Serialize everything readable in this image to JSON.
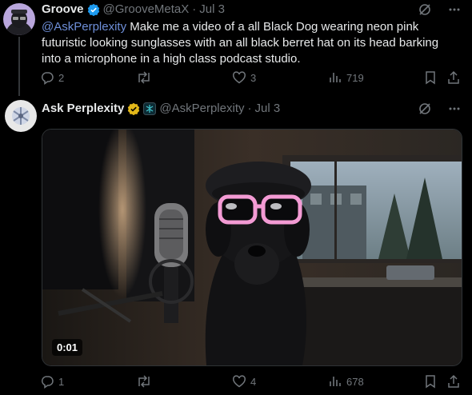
{
  "tweets": [
    {
      "author": "Groove",
      "handle": "@GrooveMetaX",
      "separator": "·",
      "date": "Jul 3",
      "mention": "@AskPerplexity",
      "text": " Make me a video of a all Black Dog wearing neon pink futuristic looking sunglasses with an all black berret hat on its head barking into a microphone in a high class podcast studio.",
      "replies": "2",
      "likes": "3",
      "views": "719"
    },
    {
      "author": "Ask Perplexity",
      "handle": "@AskPerplexity",
      "separator": "·",
      "date": "Jul 3",
      "video_timestamp": "0:01",
      "replies": "1",
      "likes": "4",
      "views": "678"
    }
  ],
  "colors": {
    "background": "#000000",
    "text": "#e7e9ea",
    "muted": "#71767b",
    "mention": "#6e8fd8",
    "verified_blue": "#1d9bf0",
    "verified_gold": "#e2b719"
  },
  "icons": [
    "grok-icon",
    "more-icon",
    "reply-icon",
    "retweet-icon",
    "like-icon",
    "views-icon",
    "bookmark-icon",
    "share-icon"
  ]
}
